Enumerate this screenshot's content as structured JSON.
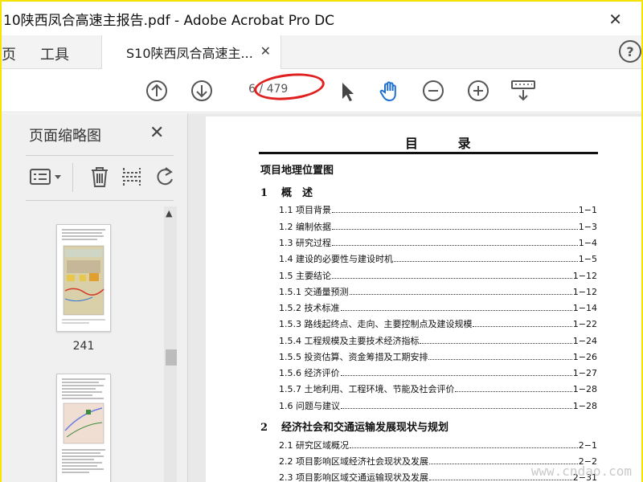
{
  "window": {
    "title": "10陕西凤合高速主报告.pdf - Adobe Acrobat Pro DC",
    "close_glyph": "✕"
  },
  "tabs": {
    "home": "页",
    "tools": "工具",
    "document": "S10陕西凤合高速主...",
    "document_close": "✕",
    "help": "?"
  },
  "toolbar": {
    "current_page": "6",
    "total_pages": "/ 479",
    "icons": [
      "prev-page-icon",
      "next-page-icon",
      "select-arrow-icon",
      "hand-icon",
      "zoom-out-icon",
      "zoom-in-icon",
      "keyboard-scroll-icon"
    ]
  },
  "sidebar": {
    "title": "页面缩略图",
    "close_glyph": "✕",
    "thumbnails": [
      {
        "label": "241"
      },
      {
        "label": ""
      }
    ]
  },
  "document": {
    "heading": "目 录",
    "sections": [
      {
        "num": "",
        "title": "项目地理位置图"
      },
      {
        "num": "1",
        "title": "概　述"
      },
      {
        "num": "2",
        "title": "经济社会和交通运输发展现状与规划"
      }
    ],
    "rows": [
      {
        "text": "1.1 项目背景",
        "page": "1−1"
      },
      {
        "text": "1.2 编制依据",
        "page": "1−3"
      },
      {
        "text": "1.3 研究过程",
        "page": "1−4"
      },
      {
        "text": "1.4 建设的必要性与建设时机",
        "page": "1−5"
      },
      {
        "text": "1.5 主要结论",
        "page": "1−12"
      },
      {
        "text": "1.5.1 交通量预测",
        "page": "1−12"
      },
      {
        "text": "1.5.2 技术标准",
        "page": "1−14"
      },
      {
        "text": "1.5.3 路线起终点、走向、主要控制点及建设规模",
        "page": "1−22"
      },
      {
        "text": "1.5.4 工程规模及主要技术经济指标",
        "page": "1−24"
      },
      {
        "text": "1.5.5 投资估算、资金筹措及工期安排",
        "page": "1−26"
      },
      {
        "text": "1.5.6 经济评价",
        "page": "1−27"
      },
      {
        "text": "1.5.7 土地利用、工程环境、节能及社会评价",
        "page": "1−28"
      },
      {
        "text": "1.6 问题与建议",
        "page": "1−28"
      },
      {
        "text": "2.1 研究区域概况",
        "page": "2−1"
      },
      {
        "text": "2.2 项目影响区域经济社会现状及发展",
        "page": "2−2"
      },
      {
        "text": "2.3 项目影响区域交通运输现状及发展",
        "page": "2−31"
      }
    ]
  },
  "watermark": "www.cndao.com",
  "colors": {
    "accent_blue": "#1f6fd1",
    "annotation_red": "#e0201e",
    "frame_yellow": "#f5e300"
  }
}
